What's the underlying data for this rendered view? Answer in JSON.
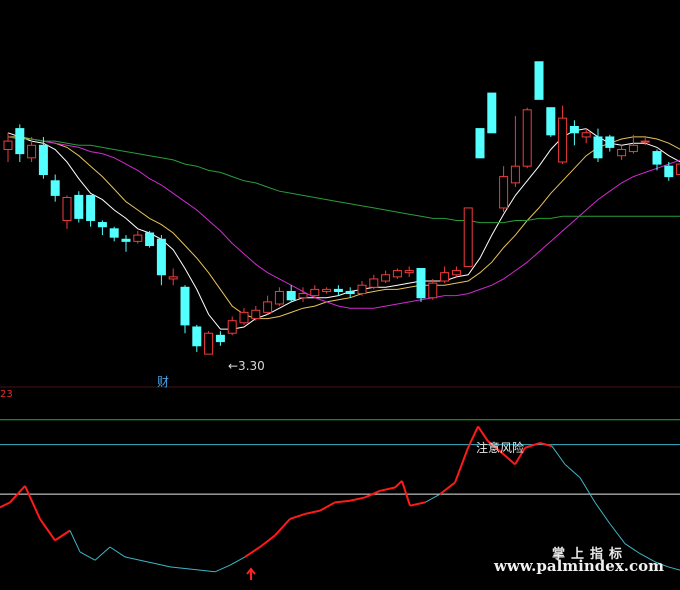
{
  "chart_data": [
    {
      "type": "candlestick",
      "title": "",
      "annotations": [
        {
          "text": "←3.30",
          "name": "low-label"
        },
        {
          "text": "财",
          "name": "finance-marker"
        }
      ],
      "candles": [
        {
          "o": 4.28,
          "c": 4.32,
          "h": 4.36,
          "l": 4.22,
          "up": true
        },
        {
          "o": 4.38,
          "c": 4.26,
          "h": 4.4,
          "l": 4.22,
          "up": false
        },
        {
          "o": 4.24,
          "c": 4.3,
          "h": 4.34,
          "l": 4.22,
          "up": true
        },
        {
          "o": 4.3,
          "c": 4.16,
          "h": 4.34,
          "l": 4.14,
          "up": false
        },
        {
          "o": 4.13,
          "c": 4.06,
          "h": 4.16,
          "l": 4.03,
          "up": false
        },
        {
          "o": 3.94,
          "c": 4.05,
          "h": 4.06,
          "l": 3.9,
          "up": true
        },
        {
          "o": 4.06,
          "c": 3.95,
          "h": 4.08,
          "l": 3.93,
          "up": false
        },
        {
          "o": 4.06,
          "c": 3.94,
          "h": 4.06,
          "l": 3.91,
          "up": false
        },
        {
          "o": 3.93,
          "c": 3.91,
          "h": 3.94,
          "l": 3.87,
          "up": false
        },
        {
          "o": 3.9,
          "c": 3.86,
          "h": 3.91,
          "l": 3.84,
          "up": false
        },
        {
          "o": 3.85,
          "c": 3.84,
          "h": 3.87,
          "l": 3.79,
          "up": false
        },
        {
          "o": 3.84,
          "c": 3.87,
          "h": 3.89,
          "l": 3.83,
          "up": true
        },
        {
          "o": 3.88,
          "c": 3.82,
          "h": 3.89,
          "l": 3.81,
          "up": false
        },
        {
          "o": 3.85,
          "c": 3.68,
          "h": 3.87,
          "l": 3.63,
          "up": false
        },
        {
          "o": 3.67,
          "c": 3.66,
          "h": 3.71,
          "l": 3.63,
          "up": true
        },
        {
          "o": 3.62,
          "c": 3.44,
          "h": 3.63,
          "l": 3.4,
          "up": false
        },
        {
          "o": 3.43,
          "c": 3.34,
          "h": 3.44,
          "l": 3.31,
          "up": false
        },
        {
          "o": 3.3,
          "c": 3.4,
          "h": 3.41,
          "l": 3.3,
          "up": true
        },
        {
          "o": 3.39,
          "c": 3.36,
          "h": 3.41,
          "l": 3.34,
          "up": false
        },
        {
          "o": 3.4,
          "c": 3.46,
          "h": 3.48,
          "l": 3.39,
          "up": true
        },
        {
          "o": 3.45,
          "c": 3.5,
          "h": 3.52,
          "l": 3.44,
          "up": true
        },
        {
          "o": 3.47,
          "c": 3.51,
          "h": 3.53,
          "l": 3.46,
          "up": true
        },
        {
          "o": 3.5,
          "c": 3.55,
          "h": 3.58,
          "l": 3.49,
          "up": true
        },
        {
          "o": 3.54,
          "c": 3.6,
          "h": 3.62,
          "l": 3.53,
          "up": true
        },
        {
          "o": 3.6,
          "c": 3.56,
          "h": 3.63,
          "l": 3.55,
          "up": false
        },
        {
          "o": 3.57,
          "c": 3.59,
          "h": 3.62,
          "l": 3.55,
          "up": true
        },
        {
          "o": 3.58,
          "c": 3.61,
          "h": 3.63,
          "l": 3.57,
          "up": true
        },
        {
          "o": 3.6,
          "c": 3.61,
          "h": 3.62,
          "l": 3.59,
          "up": true
        },
        {
          "o": 3.61,
          "c": 3.6,
          "h": 3.63,
          "l": 3.58,
          "up": false
        },
        {
          "o": 3.6,
          "c": 3.59,
          "h": 3.62,
          "l": 3.57,
          "up": false
        },
        {
          "o": 3.59,
          "c": 3.63,
          "h": 3.65,
          "l": 3.58,
          "up": true
        },
        {
          "o": 3.62,
          "c": 3.66,
          "h": 3.68,
          "l": 3.61,
          "up": true
        },
        {
          "o": 3.65,
          "c": 3.68,
          "h": 3.7,
          "l": 3.64,
          "up": true
        },
        {
          "o": 3.67,
          "c": 3.7,
          "h": 3.71,
          "l": 3.66,
          "up": true
        },
        {
          "o": 3.69,
          "c": 3.7,
          "h": 3.72,
          "l": 3.67,
          "up": true
        },
        {
          "o": 3.71,
          "c": 3.57,
          "h": 3.71,
          "l": 3.55,
          "up": false
        },
        {
          "o": 3.57,
          "c": 3.64,
          "h": 3.66,
          "l": 3.56,
          "up": true
        },
        {
          "o": 3.65,
          "c": 3.69,
          "h": 3.72,
          "l": 3.64,
          "up": true
        },
        {
          "o": 3.68,
          "c": 3.7,
          "h": 3.72,
          "l": 3.67,
          "up": true
        },
        {
          "o": 3.72,
          "c": 4.0,
          "h": 4.0,
          "l": 3.72,
          "up": true
        },
        {
          "o": 4.38,
          "c": 4.24,
          "h": 4.38,
          "l": 4.24,
          "up": false
        },
        {
          "o": 4.55,
          "c": 4.36,
          "h": 4.55,
          "l": 4.36,
          "up": false
        },
        {
          "o": 4.0,
          "c": 4.15,
          "h": 4.2,
          "l": 3.98,
          "up": true
        },
        {
          "o": 4.12,
          "c": 4.2,
          "h": 4.44,
          "l": 4.1,
          "up": true
        },
        {
          "o": 4.2,
          "c": 4.47,
          "h": 4.48,
          "l": 4.19,
          "up": true
        },
        {
          "o": 4.7,
          "c": 4.52,
          "h": 4.7,
          "l": 4.52,
          "up": false
        },
        {
          "o": 4.48,
          "c": 4.35,
          "h": 4.48,
          "l": 4.34,
          "up": false
        },
        {
          "o": 4.22,
          "c": 4.43,
          "h": 4.49,
          "l": 4.21,
          "up": true
        },
        {
          "o": 4.39,
          "c": 4.36,
          "h": 4.42,
          "l": 4.3,
          "up": false
        },
        {
          "o": 4.34,
          "c": 4.36,
          "h": 4.38,
          "l": 4.31,
          "up": true
        },
        {
          "o": 4.34,
          "c": 4.24,
          "h": 4.38,
          "l": 4.22,
          "up": false
        },
        {
          "o": 4.34,
          "c": 4.29,
          "h": 4.35,
          "l": 4.27,
          "up": false
        },
        {
          "o": 4.25,
          "c": 4.28,
          "h": 4.3,
          "l": 4.23,
          "up": true
        },
        {
          "o": 4.27,
          "c": 4.3,
          "h": 4.35,
          "l": 4.26,
          "up": true
        },
        {
          "o": 4.32,
          "c": 4.32,
          "h": 4.34,
          "l": 4.3,
          "up": true
        },
        {
          "o": 4.27,
          "c": 4.21,
          "h": 4.28,
          "l": 4.18,
          "up": false
        },
        {
          "o": 4.2,
          "c": 4.15,
          "h": 4.22,
          "l": 4.13,
          "up": false
        },
        {
          "o": 4.16,
          "c": 4.21,
          "h": 4.24,
          "l": 4.14,
          "up": true
        }
      ],
      "ma_lines": [
        {
          "color": "#ffffff",
          "values": [
            4.36,
            4.34,
            4.32,
            4.31,
            4.28,
            4.22,
            4.14,
            4.07,
            4.04,
            3.99,
            3.95,
            3.9,
            3.88,
            3.85,
            3.8,
            3.71,
            3.61,
            3.49,
            3.42,
            3.42,
            3.43,
            3.47,
            3.49,
            3.52,
            3.55,
            3.57,
            3.57,
            3.57,
            3.58,
            3.6,
            3.61,
            3.62,
            3.62,
            3.63,
            3.64,
            3.65,
            3.65,
            3.65,
            3.67,
            3.68,
            3.76,
            3.87,
            3.97,
            4.06,
            4.13,
            4.2,
            4.28,
            4.34,
            4.37,
            4.38,
            4.34,
            4.31,
            4.3,
            4.31,
            4.31,
            4.29,
            4.25,
            4.22
          ]
        },
        {
          "color": "#e8c25a",
          "values": [
            4.34,
            4.34,
            4.33,
            4.32,
            4.31,
            4.29,
            4.25,
            4.2,
            4.15,
            4.09,
            4.03,
            3.99,
            3.95,
            3.92,
            3.88,
            3.82,
            3.76,
            3.69,
            3.61,
            3.53,
            3.49,
            3.47,
            3.47,
            3.48,
            3.5,
            3.52,
            3.53,
            3.55,
            3.56,
            3.57,
            3.59,
            3.6,
            3.61,
            3.61,
            3.62,
            3.63,
            3.63,
            3.63,
            3.64,
            3.65,
            3.69,
            3.74,
            3.81,
            3.87,
            3.94,
            4.0,
            4.07,
            4.13,
            4.19,
            4.25,
            4.29,
            4.31,
            4.33,
            4.34,
            4.34,
            4.33,
            4.31,
            4.28
          ]
        },
        {
          "color": "#d02ad0",
          "values": [
            4.34,
            4.33,
            4.33,
            4.32,
            4.31,
            4.3,
            4.29,
            4.27,
            4.26,
            4.24,
            4.21,
            4.18,
            4.14,
            4.11,
            4.07,
            4.03,
            3.99,
            3.94,
            3.89,
            3.83,
            3.78,
            3.73,
            3.69,
            3.66,
            3.63,
            3.6,
            3.57,
            3.55,
            3.53,
            3.52,
            3.52,
            3.52,
            3.53,
            3.54,
            3.55,
            3.56,
            3.57,
            3.58,
            3.58,
            3.59,
            3.61,
            3.63,
            3.66,
            3.7,
            3.74,
            3.79,
            3.84,
            3.89,
            3.94,
            3.99,
            4.04,
            4.08,
            4.12,
            4.15,
            4.17,
            4.19,
            4.21,
            4.23
          ]
        },
        {
          "color": "#2a9d3a",
          "values": [
            4.34,
            4.33,
            4.33,
            4.32,
            4.32,
            4.31,
            4.3,
            4.3,
            4.29,
            4.28,
            4.27,
            4.26,
            4.25,
            4.24,
            4.23,
            4.21,
            4.2,
            4.18,
            4.17,
            4.15,
            4.13,
            4.12,
            4.1,
            4.08,
            4.07,
            4.06,
            4.05,
            4.04,
            4.03,
            4.02,
            4.01,
            4.0,
            3.99,
            3.98,
            3.97,
            3.96,
            3.95,
            3.95,
            3.94,
            3.94,
            3.93,
            3.93,
            3.93,
            3.94,
            3.94,
            3.95,
            3.95,
            3.96,
            3.96,
            3.96,
            3.96,
            3.96,
            3.96,
            3.96,
            3.96,
            3.96,
            3.96,
            3.96
          ]
        }
      ],
      "y_range": [
        3.2,
        4.9
      ]
    },
    {
      "type": "line",
      "title": "",
      "annotations": [
        {
          "text": "注意风险",
          "name": "risk-label"
        }
      ],
      "y_range": [
        -5,
        110
      ],
      "levels": [
        {
          "value": 95,
          "color": "#1fae3a"
        },
        {
          "value": 80,
          "color": "#3ab4c8"
        },
        {
          "value": 50,
          "color": "#e8e8e8"
        }
      ],
      "series_points": [
        [
          0,
          42
        ],
        [
          10,
          45
        ],
        [
          25,
          55
        ],
        [
          40,
          35
        ],
        [
          55,
          22
        ],
        [
          70,
          28
        ],
        [
          80,
          15
        ],
        [
          95,
          10
        ],
        [
          110,
          18
        ],
        [
          125,
          12
        ],
        [
          140,
          10
        ],
        [
          155,
          8
        ],
        [
          170,
          6
        ],
        [
          185,
          5
        ],
        [
          200,
          4
        ],
        [
          215,
          3
        ],
        [
          230,
          7
        ],
        [
          245,
          12
        ],
        [
          260,
          18
        ],
        [
          275,
          25
        ],
        [
          290,
          35
        ],
        [
          305,
          38
        ],
        [
          320,
          40
        ],
        [
          335,
          45
        ],
        [
          350,
          46
        ],
        [
          365,
          48
        ],
        [
          380,
          52
        ],
        [
          395,
          54
        ],
        [
          402,
          58
        ],
        [
          410,
          43
        ],
        [
          425,
          45
        ],
        [
          440,
          50
        ],
        [
          455,
          57
        ],
        [
          468,
          78
        ],
        [
          478,
          91
        ],
        [
          488,
          82
        ],
        [
          500,
          76
        ],
        [
          515,
          68
        ],
        [
          525,
          78
        ],
        [
          540,
          81
        ],
        [
          552,
          79
        ],
        [
          565,
          68
        ],
        [
          580,
          60
        ],
        [
          595,
          45
        ],
        [
          610,
          32
        ],
        [
          625,
          20
        ],
        [
          640,
          14
        ],
        [
          655,
          9
        ],
        [
          668,
          6
        ],
        [
          680,
          4
        ]
      ],
      "red_segments": [
        [
          0,
          5
        ],
        [
          17,
          30
        ],
        [
          31,
          40
        ]
      ]
    }
  ],
  "labels": {
    "low": "←3.30",
    "finance": "财",
    "risk": "注意风险",
    "left_value": "23"
  },
  "watermark": {
    "title": "掌上指标",
    "url": "www.palmindex.com"
  },
  "colors": {
    "up": "#f03c3c",
    "down": "#54ffff",
    "background": "#000000"
  }
}
